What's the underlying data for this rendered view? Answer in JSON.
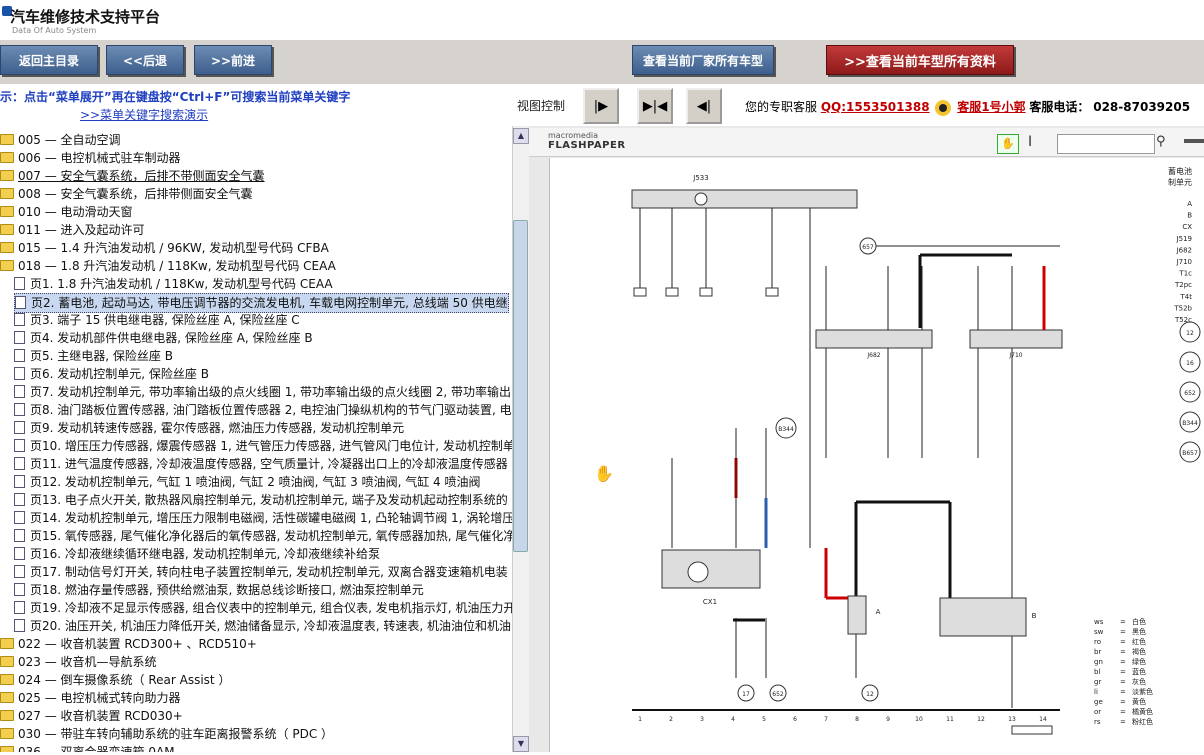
{
  "header": {
    "title": "汽车维修技术支持平台",
    "subtitle": "Data Of Auto System"
  },
  "nav": {
    "home": "返回主目录",
    "back": "<<后退",
    "forward": ">>前进",
    "all_models": "查看当前厂家所有车型",
    "current_model": ">>查看当前车型所有资料"
  },
  "hint": {
    "text": "示：点击“菜单展开”再在键盘按“Ctrl+F”可搜索当前菜单关键字",
    "link": ">>菜单关键字搜索演示"
  },
  "view_control": {
    "label": "视图控制"
  },
  "customer_service": {
    "prefix": "您的专职客服",
    "qq": "QQ:1553501388",
    "name": "客服1号小郭",
    "phone_label": "客服电话：",
    "phone": "028-87039205"
  },
  "tree": {
    "items": [
      {
        "type": "folder",
        "label": "005 — 全自动空调"
      },
      {
        "type": "folder",
        "label": "006 — 电控机械式驻车制动器"
      },
      {
        "type": "folder",
        "label": "007 — 安全气囊系统，后排不带侧面安全气囊"
      },
      {
        "type": "folder",
        "label": "008 — 安全气囊系统，后排带侧面安全气囊"
      },
      {
        "type": "folder",
        "label": "010 — 电动滑动天窗"
      },
      {
        "type": "folder",
        "label": "011 — 进入及起动许可"
      },
      {
        "type": "folder",
        "label": "015 — 1.4 升汽油发动机 / 96KW, 发动机型号代码 CFBA"
      },
      {
        "type": "folder",
        "label": "018 — 1.8 升汽油发动机 / 118Kw, 发动机型号代码 CEAA"
      },
      {
        "type": "page",
        "label": "页1. 1.8 升汽油发动机 / 118Kw, 发动机型号代码 CEAA"
      },
      {
        "type": "page",
        "label": "页2. 蓄电池, 起动马达, 带电压调节器的交流发电机, 车载电网控制单元, 总线端 50 供电继"
      },
      {
        "type": "page",
        "label": "页3. 端子 15 供电继电器, 保险丝座 A, 保险丝座 C"
      },
      {
        "type": "page",
        "label": "页4. 发动机部件供电继电器, 保险丝座 A, 保险丝座 B"
      },
      {
        "type": "page",
        "label": "页5. 主继电器, 保险丝座 B"
      },
      {
        "type": "page",
        "label": "页6. 发动机控制单元, 保险丝座 B"
      },
      {
        "type": "page",
        "label": "页7. 发动机控制单元, 带功率输出级的点火线圈 1, 带功率输出级的点火线圈 2, 带功率输出"
      },
      {
        "type": "page",
        "label": "页8. 油门踏板位置传感器, 油门踏板位置传感器 2, 电控油门操纵机构的节气门驱动装置, 电"
      },
      {
        "type": "page",
        "label": "页9. 发动机转速传感器, 霍尔传感器, 燃油压力传感器, 发动机控制单元"
      },
      {
        "type": "page",
        "label": "页10. 增压压力传感器, 爆震传感器 1, 进气管压力传感器, 进气管风门电位计, 发动机控制单"
      },
      {
        "type": "page",
        "label": "页11. 进气温度传感器, 冷却液温度传感器, 空气质量计, 冷凝器出口上的冷却液温度传感器"
      },
      {
        "type": "page",
        "label": "页12. 发动机控制单元, 气缸 1 喷油阀, 气缸 2 喷油阀, 气缸 3 喷油阀, 气缸 4 喷油阀"
      },
      {
        "type": "page",
        "label": "页13. 电子点火开关, 散热器风扇控制单元, 发动机控制单元, 端子及发动机起动控制系统的"
      },
      {
        "type": "page",
        "label": "页14. 发动机控制单元, 增压压力限制电磁阀, 活性碳罐电磁阀 1, 凸轮轴调节阀 1, 涡轮增压"
      },
      {
        "type": "page",
        "label": "页15. 氧传感器, 尾气催化净化器后的氧传感器, 发动机控制单元, 氧传感器加热, 尾气催化净"
      },
      {
        "type": "page",
        "label": "页16. 冷却液继续循环继电器, 发动机控制单元, 冷却液继续补给泵"
      },
      {
        "type": "page",
        "label": "页17. 制动信号灯开关, 转向柱电子装置控制单元, 发动机控制单元, 双离合器变速箱机电装"
      },
      {
        "type": "page",
        "label": "页18. 燃油存量传感器, 预供给燃油泵, 数据总线诊断接口, 燃油泵控制单元"
      },
      {
        "type": "page",
        "label": "页19. 冷却液不足显示传感器, 组合仪表中的控制单元, 组合仪表, 发电机指示灯, 机油压力开"
      },
      {
        "type": "page",
        "label": "页20. 油压开关, 机油压力降低开关, 燃油储备显示, 冷却液温度表, 转速表, 机油油位和机油"
      },
      {
        "type": "folder",
        "label": "022 — 收音机装置 RCD300+ 、RCD510+"
      },
      {
        "type": "folder",
        "label": "023 — 收音机—导航系统"
      },
      {
        "type": "folder",
        "label": "024 — 倒车摄像系统（ Rear Assist ）"
      },
      {
        "type": "folder",
        "label": "025 — 电控机械式转向助力器"
      },
      {
        "type": "folder",
        "label": "027 — 收音机装置 RCD030+"
      },
      {
        "type": "folder",
        "label": "030 — 带驻车转向辅助系统的驻车距离报警系统（ PDC ）"
      },
      {
        "type": "folder",
        "label": "036 — 双离合器变速箱 0AM"
      }
    ]
  },
  "viewer": {
    "brand_top": "macromedia",
    "brand_main": "FLASHPAPER",
    "icons": {
      "hand": "hand-tool-icon",
      "text": "text-cursor-icon",
      "search": "magnifier-icon"
    }
  },
  "diagram": {
    "top_bus_label": "J533",
    "right_title_1": "蓄电池",
    "right_title_2": "制单元",
    "right_codes": [
      "A",
      "B",
      "CX",
      "J519",
      "J682",
      "J710",
      "T1c",
      "T2pc",
      "T4t",
      "T52b",
      "T52c"
    ],
    "circles_right": [
      "12",
      "16",
      "652",
      "B344",
      "B657"
    ],
    "bottom_numbers": [
      "1",
      "2",
      "3",
      "4",
      "5",
      "6",
      "7",
      "8",
      "9",
      "10",
      "11",
      "12",
      "13",
      "14"
    ],
    "component_labels": [
      "CX1",
      "A",
      "B",
      "J682",
      "J710"
    ],
    "circle_labels": [
      "657",
      "B344",
      "17",
      "652",
      "12"
    ],
    "legend": [
      {
        "code": "ws",
        "eq": "=",
        "name": "白色"
      },
      {
        "code": "sw",
        "eq": "=",
        "name": "黑色"
      },
      {
        "code": "ro",
        "eq": "=",
        "name": "红色"
      },
      {
        "code": "br",
        "eq": "=",
        "name": "褐色"
      },
      {
        "code": "gn",
        "eq": "=",
        "name": "绿色"
      },
      {
        "code": "bl",
        "eq": "=",
        "name": "蓝色"
      },
      {
        "code": "gr",
        "eq": "=",
        "name": "灰色"
      },
      {
        "code": "li",
        "eq": "=",
        "name": "淡紫色"
      },
      {
        "code": "ge",
        "eq": "=",
        "name": "黄色"
      },
      {
        "code": "or",
        "eq": "=",
        "name": "橘黄色"
      },
      {
        "code": "rs",
        "eq": "=",
        "name": "粉红色"
      }
    ]
  }
}
